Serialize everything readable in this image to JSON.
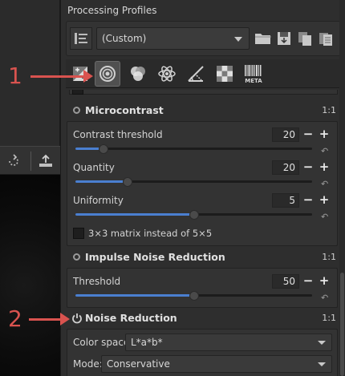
{
  "preview_toolbar": {
    "rotate_icon": "rotate-icon",
    "crop_icon": "crop-icon"
  },
  "profiles": {
    "title": "Processing Profiles",
    "selected": "(Custom)"
  },
  "tabs": [
    {
      "name": "exposure",
      "active": false
    },
    {
      "name": "detail",
      "active": true
    },
    {
      "name": "color",
      "active": false
    },
    {
      "name": "advanced",
      "active": false
    },
    {
      "name": "transform",
      "active": false
    },
    {
      "name": "raw",
      "active": false
    },
    {
      "name": "metadata",
      "label": "META",
      "active": false
    }
  ],
  "microcontrast": {
    "title": "Microcontrast",
    "ratio": "1:1",
    "params": [
      {
        "label": "Contrast threshold",
        "value": "20",
        "fraction": 0.12
      },
      {
        "label": "Quantity",
        "value": "20",
        "fraction": 0.22
      },
      {
        "label": "Uniformity",
        "value": "5",
        "fraction": 0.5
      }
    ],
    "matrix_checkbox_label": "3×3 matrix instead of 5×5"
  },
  "impulse_noise": {
    "title": "Impulse Noise Reduction",
    "ratio": "1:1",
    "threshold_label": "Threshold",
    "threshold_value": "50",
    "fraction": 0.5
  },
  "noise_reduction": {
    "title": "Noise Reduction",
    "ratio": "1:1",
    "color_space_label": "Color space:",
    "color_space_value": "L*a*b*",
    "mode_label": "Mode:",
    "mode_value": "Conservative"
  },
  "annotations": [
    {
      "number": "1"
    },
    {
      "number": "2"
    }
  ],
  "colors": {
    "accent": "#4a7fd0",
    "annotation": "#d9534f"
  }
}
